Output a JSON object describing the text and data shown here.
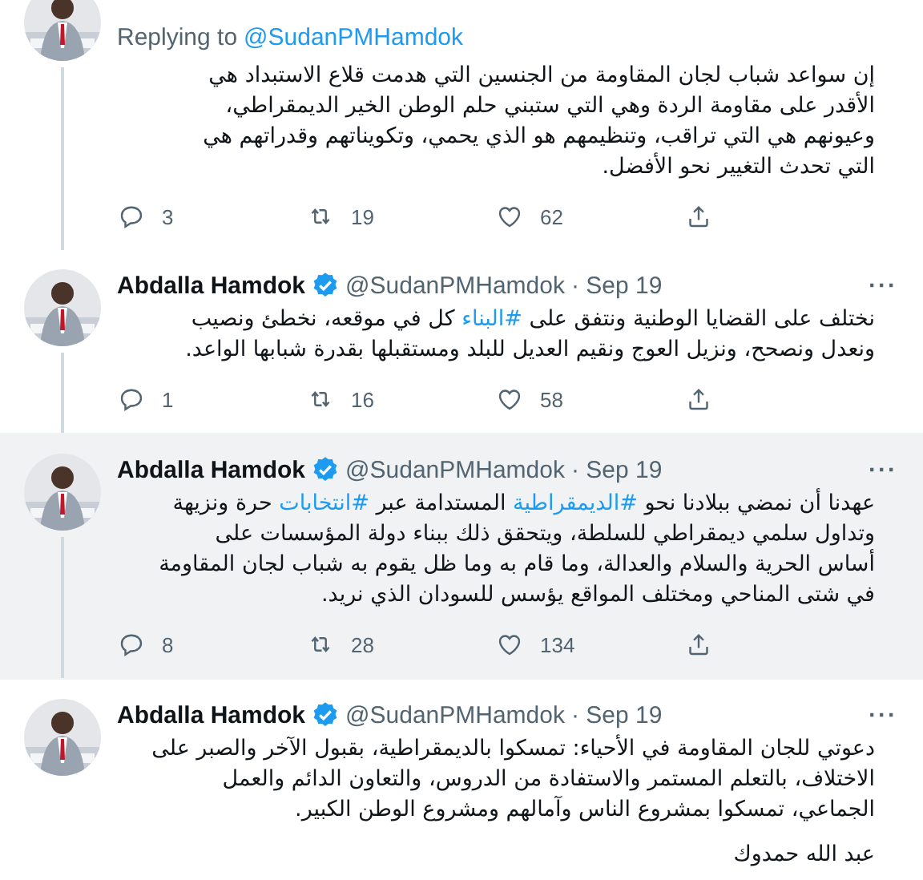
{
  "tweets": [
    {
      "replying_to": {
        "label": "Replying to",
        "handle": "@SudanPMHamdok"
      },
      "thread_line": true,
      "highlighted": false,
      "divider_above": false,
      "lines": [
        [
          {
            "text": "إن سواعد شباب لجان المقاومة من الجنسين التي هدمت قلاع الاستبداد هي",
            "hashtag": false
          }
        ],
        [
          {
            "text": "الأقدر على مقاومة الردة وهي التي ستبني حلم الوطن الخير الديمقراطي،",
            "hashtag": false
          }
        ],
        [
          {
            "text": "وعيونهم هي التي تراقب، وتنظيمهم هو الذي يحمي، وتكويناتهم وقدراتهم هي",
            "hashtag": false
          }
        ],
        [
          {
            "text": "التي تحدث التغيير نحو الأفضل.",
            "hashtag": false
          }
        ]
      ],
      "actions": {
        "replies": "3",
        "retweets": "19",
        "likes": "62"
      }
    },
    {
      "author": {
        "name": "Abdalla Hamdok",
        "handle": "@SudanPMHamdok",
        "date": "· Sep 19",
        "more": "···"
      },
      "thread_line": true,
      "highlighted": false,
      "divider_above": false,
      "lines": [
        [
          {
            "text": "نختلف على القضايا الوطنية ونتفق على ",
            "hashtag": false
          },
          {
            "text": "#البناء",
            "hashtag": true
          },
          {
            "text": " كل في موقعه، نخطئ ونصيب",
            "hashtag": false
          }
        ],
        [
          {
            "text": "ونعدل ونصحح، ونزيل العوج ونقيم العديل للبلد ومستقبلها بقدرة شبابها الواعد.",
            "hashtag": false
          }
        ]
      ],
      "actions": {
        "replies": "1",
        "retweets": "16",
        "likes": "58"
      }
    },
    {
      "author": {
        "name": "Abdalla Hamdok",
        "handle": "@SudanPMHamdok",
        "date": "· Sep 19",
        "more": "···"
      },
      "thread_line": true,
      "highlighted": true,
      "divider_above": true,
      "lines": [
        [
          {
            "text": "عهدنا أن نمضي ببلادنا نحو ",
            "hashtag": false
          },
          {
            "text": "#الديمقراطية",
            "hashtag": true
          },
          {
            "text": " المستدامة عبر ",
            "hashtag": false
          },
          {
            "text": "#انتخابات",
            "hashtag": true
          },
          {
            "text": " حرة ونزيهة",
            "hashtag": false
          }
        ],
        [
          {
            "text": "وتداول سلمي ديمقراطي للسلطة، ويتحقق ذلك ببناء دولة المؤسسات على",
            "hashtag": false
          }
        ],
        [
          {
            "text": "أساس الحرية والسلام والعدالة، وما قام به وما ظل يقوم به شباب لجان المقاومة",
            "hashtag": false
          }
        ],
        [
          {
            "text": "في شتى المناحي ومختلف المواقع يؤسس للسودان الذي نريد.",
            "hashtag": false
          }
        ]
      ],
      "actions": {
        "replies": "8",
        "retweets": "28",
        "likes": "134"
      }
    },
    {
      "author": {
        "name": "Abdalla Hamdok",
        "handle": "@SudanPMHamdok",
        "date": "· Sep 19",
        "more": "···"
      },
      "thread_line": false,
      "highlighted": false,
      "divider_above": true,
      "lines": [
        [
          {
            "text": "دعوتي للجان المقاومة في الأحياء: تمسكوا بالديمقراطية، بقبول الآخر والصبر على",
            "hashtag": false
          }
        ],
        [
          {
            "text": "الاختلاف، بالتعلم المستمر والاستفادة من الدروس، والتعاون الدائم والعمل",
            "hashtag": false
          }
        ],
        [
          {
            "text": "الجماعي، تمسكوا بمشروع الناس وآمالهم ومشروع الوطن الكبير.",
            "hashtag": false
          }
        ]
      ],
      "signature": "عبد الله حمدوك"
    }
  ]
}
